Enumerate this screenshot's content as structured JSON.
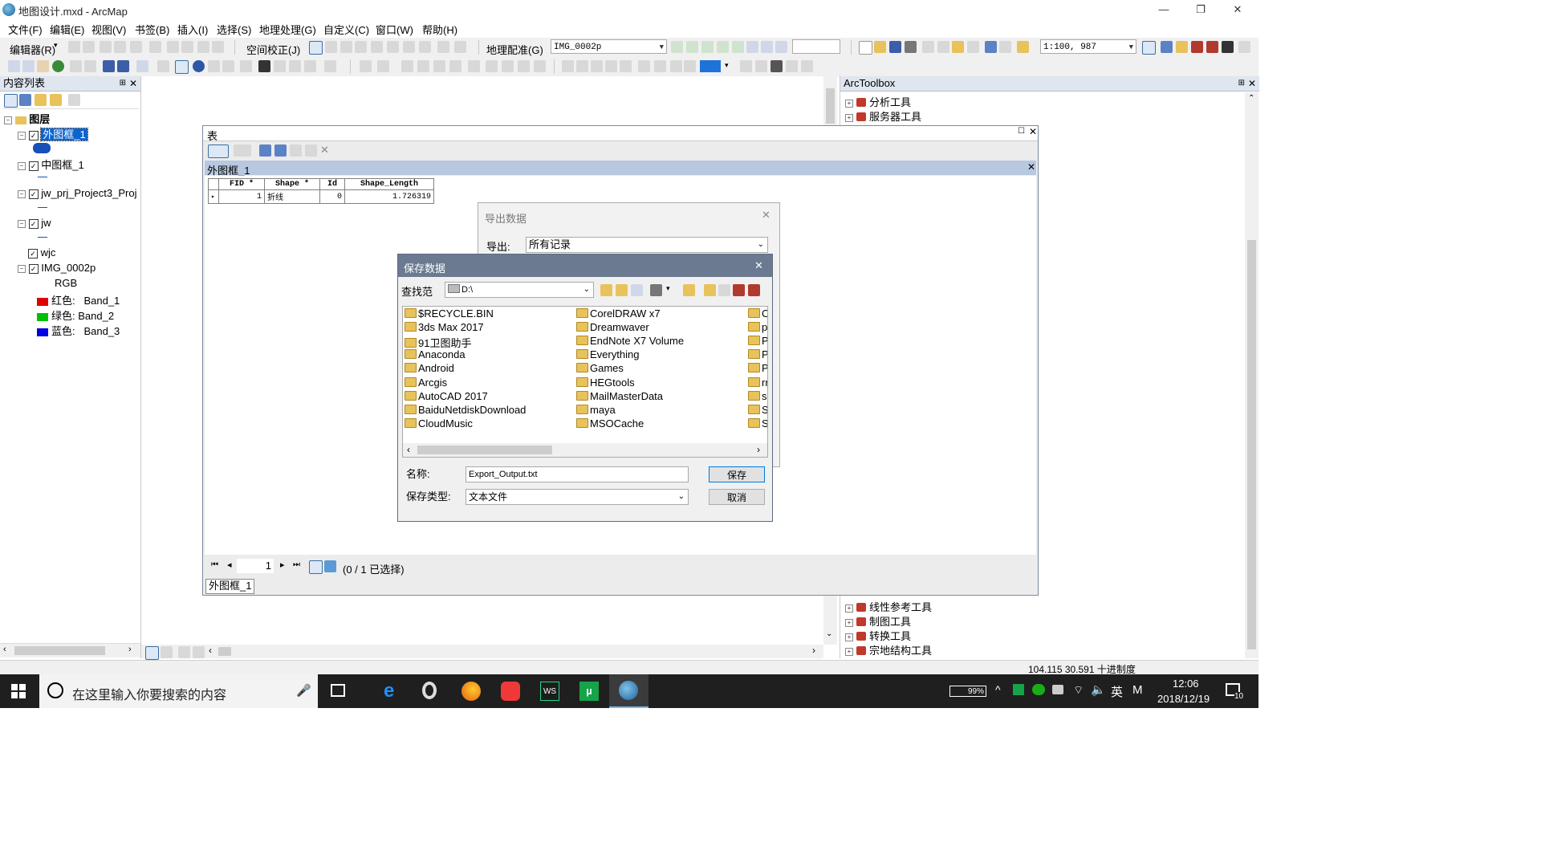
{
  "window": {
    "title": "地图设计.mxd - ArcMap",
    "min": "—",
    "restore": "❐",
    "close": "✕"
  },
  "menu": [
    "文件(F)",
    "编辑(E)",
    "视图(V)",
    "书签(B)",
    "插入(I)",
    "选择(S)",
    "地理处理(G)",
    "自定义(C)",
    "窗口(W)",
    "帮助(H)"
  ],
  "toolbar": {
    "editor_label": "编辑器(R)",
    "spatial_adjust_label": "空间校正(J)",
    "georef_label": "地理配准(G)",
    "georef_layer": "IMG_0002p",
    "scale": "1:100, 987"
  },
  "toc": {
    "title": "内容列表",
    "root": "图层",
    "layers": [
      {
        "name": "外图框_1",
        "checked": true,
        "selected": true
      },
      {
        "name": "中图框_1",
        "checked": true
      },
      {
        "name": "jw_prj_Project3_Proj",
        "checked": true
      },
      {
        "name": "jw",
        "checked": true
      },
      {
        "name": "wjc",
        "checked": true
      },
      {
        "name": "IMG_0002p",
        "checked": true
      }
    ],
    "rgb": "RGB",
    "bands": [
      {
        "label": "红色:",
        "band": "Band_1",
        "color": "#e00000"
      },
      {
        "label": "绿色:",
        "band": "Band_2",
        "color": "#00c000"
      },
      {
        "label": "蓝色:",
        "band": "Band_3",
        "color": "#0000e0"
      }
    ]
  },
  "table_window": {
    "title": "表",
    "tab_title": "外图框_1",
    "columns": [
      "FID *",
      "Shape *",
      "Id",
      "Shape_Length"
    ],
    "rows": [
      [
        "1",
        "折线",
        "0",
        "1.726319"
      ]
    ],
    "record": "1",
    "selection_status": "(0 / 1 已选择)",
    "bottom_tab": "外图框_1"
  },
  "export_dialog": {
    "title": "导出数据",
    "export_label": "导出:",
    "export_value": "所有记录"
  },
  "save_dialog": {
    "title": "保存数据",
    "look_in_label": "查找范",
    "look_in_value": "D:\\",
    "folders_col1": [
      "$RECYCLE.BIN",
      "3ds Max 2017",
      "91卫图助手",
      "Anaconda",
      "Android",
      "Arcgis",
      "AutoCAD 2017",
      "BaiduNetdiskDownload",
      "CloudMusic"
    ],
    "folders_col2": [
      "CorelDRAW x7",
      "Dreamwaver",
      "EndNote X7 Volume",
      "Everything",
      "Games",
      "HEGtools",
      "MailMasterData",
      "maya",
      "MSOCache"
    ],
    "folders_col3": [
      "O",
      "pa",
      "Pr",
      "PS",
      "Py",
      "rr",
      "sc",
      "SC",
      "SC"
    ],
    "name_label": "名称:",
    "name_value": "Export_Output.txt",
    "type_label": "保存类型:",
    "type_value": "文本文件",
    "save_btn": "保存",
    "cancel_btn": "取消"
  },
  "toolbox": {
    "title": "ArcToolbox",
    "items_top": [
      "分析工具",
      "服务器工具"
    ],
    "items_bottom": [
      "线性参考工具",
      "制图工具",
      "转换工具",
      "宗地结构工具"
    ]
  },
  "status": {
    "coords": "104.115  30.591 十进制度"
  },
  "taskbar": {
    "search_placeholder": "在这里输入你要搜索的内容",
    "battery": "99%",
    "ime": "英",
    "time": "12:06",
    "date": "2018/12/19",
    "notifications": "10"
  }
}
